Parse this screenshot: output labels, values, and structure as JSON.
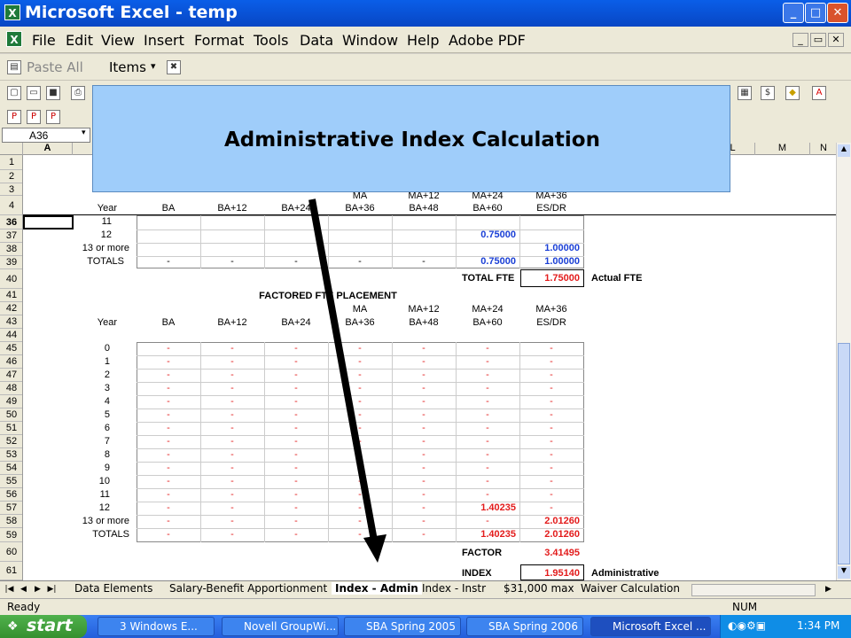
{
  "window": {
    "title": "Microsoft Excel - temp",
    "app_icon": "excel-icon"
  },
  "menu": [
    "File",
    "Edit",
    "View",
    "Insert",
    "Format",
    "Tools",
    "Data",
    "Window",
    "Help",
    "Adobe PDF"
  ],
  "toolbar": {
    "paste_all": "Paste All",
    "items": "Items"
  },
  "name_box": "A36",
  "columns": [
    "A",
    "L",
    "M",
    "N"
  ],
  "callout": "Administrative Index Calculation",
  "rows": [
    "1",
    "2",
    "3",
    "4",
    "36",
    "37",
    "38",
    "39",
    "40",
    "41",
    "42",
    "43",
    "44",
    "45",
    "46",
    "47",
    "48",
    "49",
    "50",
    "51",
    "52",
    "53",
    "54",
    "55",
    "56",
    "57",
    "58",
    "59",
    "60",
    "61"
  ],
  "header_top": {
    "col4_line1": "MA",
    "col5_line1": "MA+12",
    "col6_line1": "MA+24",
    "col7_line1": "MA+36",
    "year": "Year",
    "c1": "BA",
    "c2": "BA+12",
    "c3": "BA+24",
    "c4": "BA+36",
    "c5": "BA+48",
    "c6": "BA+60",
    "c7": "ES/DR"
  },
  "upper_block": {
    "r36": "11",
    "r37": "12",
    "r38": "13 or more",
    "r39": "TOTALS",
    "r37_c6": "0.75000",
    "r38_c7": "1.00000",
    "r39_c6": "0.75000",
    "r39_c7": "1.00000",
    "total_fte_label": "TOTAL FTE",
    "total_fte": "1.75000",
    "actual_fte": "Actual FTE",
    "dash": "-"
  },
  "factored": {
    "title": "FACTORED FTE PLACEMENT",
    "ma": "MA",
    "ma12": "MA+12",
    "ma24": "MA+24",
    "ma36": "MA+36",
    "year": "Year",
    "c1": "BA",
    "c2": "BA+12",
    "c3": "BA+24",
    "c4": "BA+36",
    "c5": "BA+48",
    "c6": "BA+60",
    "c7": "ES/DR",
    "years": [
      "0",
      "1",
      "2",
      "3",
      "4",
      "5",
      "6",
      "7",
      "8",
      "9",
      "10",
      "11",
      "12",
      "13 or more",
      "TOTALS"
    ],
    "r57_c6": "1.40235",
    "r58_c7": "2.01260",
    "r59_c6": "1.40235",
    "r59_c7": "2.01260",
    "factor_label": "FACTOR",
    "factor": "3.41495",
    "index_label": "INDEX",
    "index": "1.95140",
    "admin": "Administrative"
  },
  "sheet_tabs": [
    "Data Elements",
    "Salary-Benefit Apportionment",
    "Index - Admin",
    "Index - Instr",
    "$31,000 max",
    "Waiver Calculation"
  ],
  "status": {
    "ready": "Ready",
    "num": "NUM"
  },
  "taskbar": {
    "start": "start",
    "tasks": [
      "3 Windows E...",
      "Novell GroupWi...",
      "SBA Spring 2005",
      "SBA Spring 2006",
      "Microsoft Excel ..."
    ],
    "clock": "1:34 PM"
  }
}
